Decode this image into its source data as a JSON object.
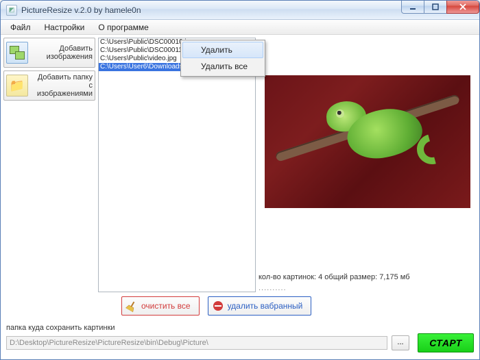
{
  "window": {
    "title": "PictureResize v.2.0        by hamele0n"
  },
  "menu": {
    "items": [
      "Файл",
      "Настройки",
      "О программе"
    ]
  },
  "sidebar": {
    "add_images": "Добавить\nизображения",
    "add_folder": "Добавить папку\nс изображениями"
  },
  "files": {
    "rows": [
      "C:\\Users\\Public\\DSC00010.jpg",
      "C:\\Users\\Public\\DSC00011.jpg",
      "C:\\Users\\Public\\video.jpg",
      "C:\\Users\\User6\\Downloads\\…"
    ],
    "selected_index": 3
  },
  "context_menu": {
    "items": [
      "Удалить",
      "Удалить все"
    ],
    "hover_index": 0
  },
  "preview": {
    "stats": "кол-во картинок: 4 общий размер: 7,175 мб",
    "progress": ".........."
  },
  "actions": {
    "clear_all": "очистить все",
    "delete_selected": "удалить вабранный"
  },
  "save": {
    "label": "папка куда сохранить картинки",
    "path": "D:\\Desktop\\PictureResize\\PictureResize\\bin\\Debug\\Picture\\",
    "browse": "...",
    "start": "СТАРТ"
  }
}
